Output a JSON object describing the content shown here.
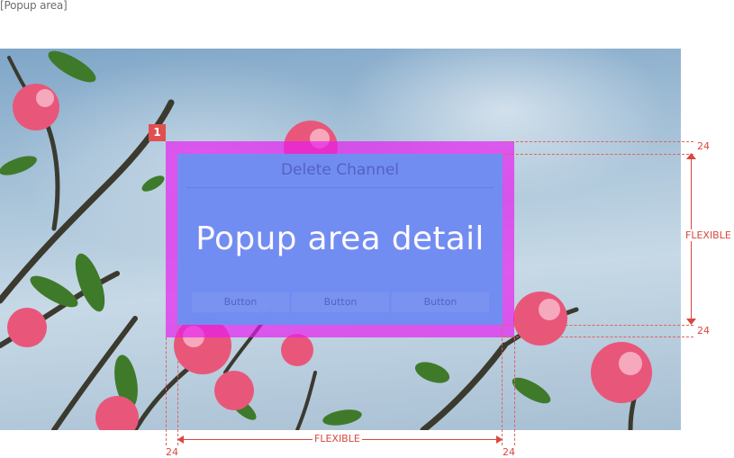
{
  "caption": "[Popup area]",
  "badge": "1",
  "popup": {
    "title": "Delete Channel",
    "detail": "Popup area detail",
    "buttons": [
      "Button",
      "Button",
      "Button"
    ]
  },
  "dimensions": {
    "top_margin": "24",
    "bottom_margin": "24",
    "height": "FLEXIBLE",
    "left_margin": "24",
    "right_margin": "24",
    "width": "FLEXIBLE"
  },
  "colors": {
    "popup_area": "#e81af0",
    "popup_detail": "#6f8ff2",
    "guide": "#d9473f"
  }
}
